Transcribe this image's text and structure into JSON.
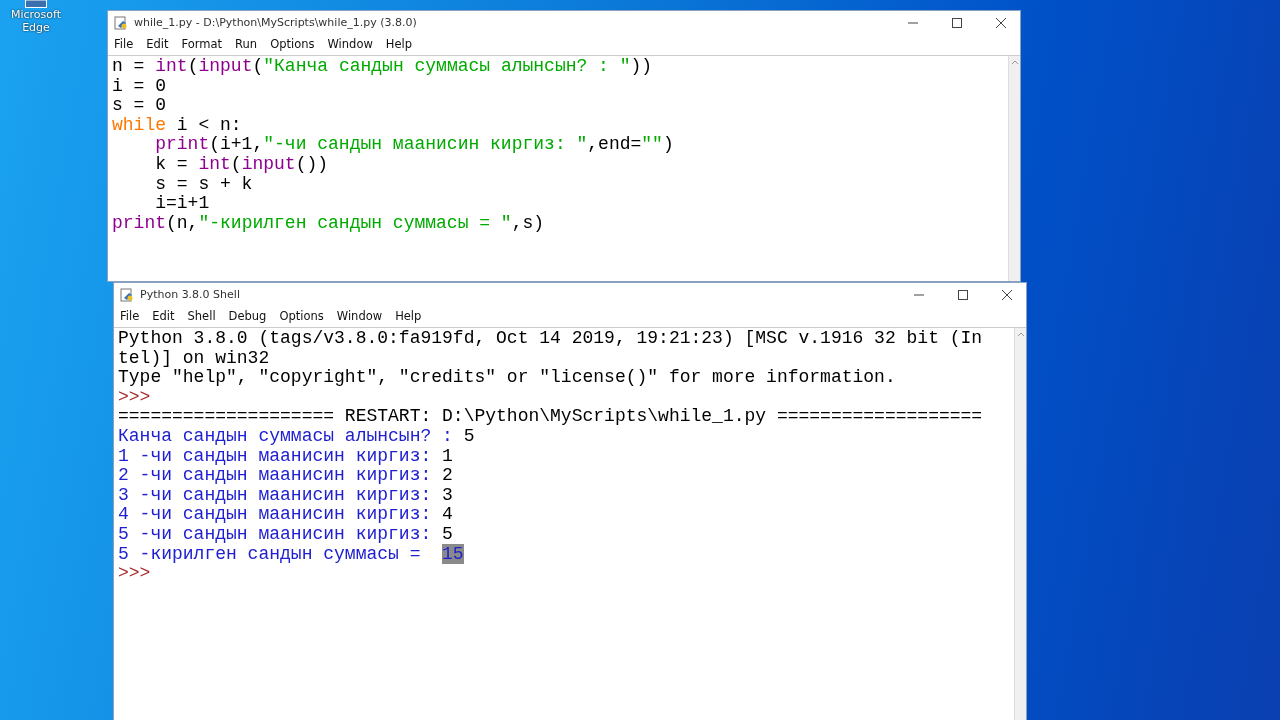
{
  "desktop": {
    "icons": [
      {
        "label": "Microsoft Edge"
      }
    ]
  },
  "editor": {
    "title": "while_1.py - D:\\Python\\MyScripts\\while_1.py (3.8.0)",
    "menu": [
      "File",
      "Edit",
      "Format",
      "Run",
      "Options",
      "Window",
      "Help"
    ],
    "lines": [
      [
        {
          "kind": "plain",
          "text": "n = "
        },
        {
          "kind": "builtin",
          "text": "int"
        },
        {
          "kind": "plain",
          "text": "("
        },
        {
          "kind": "builtin",
          "text": "input"
        },
        {
          "kind": "plain",
          "text": "("
        },
        {
          "kind": "string",
          "text": "\"Канча сандын суммасы алынсын? : \""
        },
        {
          "kind": "plain",
          "text": "))"
        }
      ],
      [
        {
          "kind": "plain",
          "text": "i = 0"
        }
      ],
      [
        {
          "kind": "plain",
          "text": "s = 0"
        }
      ],
      [
        {
          "kind": "keyword",
          "text": "while"
        },
        {
          "kind": "plain",
          "text": " i < n:"
        }
      ],
      {
        "indented": true,
        "tokens": [
          {
            "kind": "builtin",
            "text": "print"
          },
          {
            "kind": "plain",
            "text": "(i+1,"
          },
          {
            "kind": "string",
            "text": "\"-чи сандын маанисин киргиз: \""
          },
          {
            "kind": "plain",
            "text": ",end="
          },
          {
            "kind": "string",
            "text": "\"\""
          },
          {
            "kind": "plain",
            "text": ")"
          }
        ]
      },
      {
        "indented": true,
        "tokens": [
          {
            "kind": "plain",
            "text": "k = "
          },
          {
            "kind": "builtin",
            "text": "int"
          },
          {
            "kind": "plain",
            "text": "("
          },
          {
            "kind": "builtin",
            "text": "input"
          },
          {
            "kind": "plain",
            "text": "())"
          }
        ]
      },
      {
        "indented": true,
        "tokens": [
          {
            "kind": "plain",
            "text": "s = s + k"
          }
        ]
      },
      {
        "indented": true,
        "tokens": [
          {
            "kind": "plain",
            "text": "i=i+1"
          }
        ]
      },
      [
        {
          "kind": "builtin",
          "text": "print"
        },
        {
          "kind": "plain",
          "text": "(n,"
        },
        {
          "kind": "string",
          "text": "\"-кирилген сандын суммасы = \""
        },
        {
          "kind": "plain",
          "text": ",s)"
        }
      ]
    ]
  },
  "shell": {
    "title": "Python 3.8.0 Shell",
    "menu": [
      "File",
      "Edit",
      "Shell",
      "Debug",
      "Options",
      "Window",
      "Help"
    ],
    "lines": [
      [
        {
          "kind": "plain",
          "text": "Python 3.8.0 (tags/v3.8.0:fa919fd, Oct 14 2019, 19:21:23) [MSC v.1916 32 bit (In"
        }
      ],
      [
        {
          "kind": "plain",
          "text": "tel)] on win32"
        }
      ],
      [
        {
          "kind": "plain",
          "text": "Type \"help\", \"copyright\", \"credits\" or \"license()\" for more information."
        }
      ],
      [
        {
          "kind": "prompt",
          "text": ">>> "
        }
      ],
      [
        {
          "kind": "plain",
          "text": "==================== RESTART: D:\\Python\\MyScripts\\while_1.py ==================="
        }
      ],
      [
        {
          "kind": "stdout",
          "text": "Канча сандын суммасы алынсын? : "
        },
        {
          "kind": "stdin",
          "text": "5"
        }
      ],
      [
        {
          "kind": "stdout",
          "text": "1 -чи сандын маанисин киргиз: "
        },
        {
          "kind": "stdin",
          "text": "1"
        }
      ],
      [
        {
          "kind": "stdout",
          "text": "2 -чи сандын маанисин киргиз: "
        },
        {
          "kind": "stdin",
          "text": "2"
        }
      ],
      [
        {
          "kind": "stdout",
          "text": "3 -чи сандын маанисин киргиз: "
        },
        {
          "kind": "stdin",
          "text": "3"
        }
      ],
      [
        {
          "kind": "stdout",
          "text": "4 -чи сандын маанисин киргиз: "
        },
        {
          "kind": "stdin",
          "text": "4"
        }
      ],
      [
        {
          "kind": "stdout",
          "text": "5 -чи сандын маанисин киргиз: "
        },
        {
          "kind": "stdin",
          "text": "5"
        }
      ],
      [
        {
          "kind": "stdout",
          "text": "5 -кирилген сандын суммасы =  "
        },
        {
          "kind": "highlight",
          "text": "15"
        }
      ],
      [
        {
          "kind": "prompt",
          "text": ">>>"
        }
      ]
    ]
  }
}
